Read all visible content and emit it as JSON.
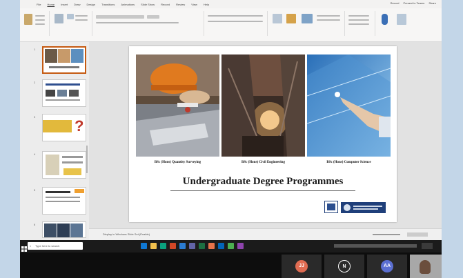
{
  "ribbon": {
    "tabs": [
      "File",
      "Home",
      "Insert",
      "Draw",
      "Design",
      "Transitions",
      "Animations",
      "Slide Show",
      "Record",
      "Review",
      "View",
      "Help"
    ],
    "share_labels": [
      "Record",
      "Present in Teams",
      "Share"
    ]
  },
  "slide_panel": {
    "numbers": [
      "1",
      "2",
      "3",
      "4",
      "5",
      "6"
    ]
  },
  "slide": {
    "captions": [
      "BSc (Hons) Quantity Surveying",
      "BSc (Hons) Civil Engineering",
      "BSc (Hons) Computer Science"
    ],
    "title": "Undergraduate Degree Programmes"
  },
  "status": {
    "notes_text": "Display in Windows Slide Set (Enable)"
  },
  "taskbar": {
    "search_placeholder": "Type here to search"
  },
  "meeting": {
    "initials": [
      "JJ",
      "N",
      "AA"
    ]
  },
  "colors": {
    "ribbon_accent": "#c55a11",
    "taskbar": "#1b1b1b",
    "backdrop": "#c3d6e8"
  }
}
